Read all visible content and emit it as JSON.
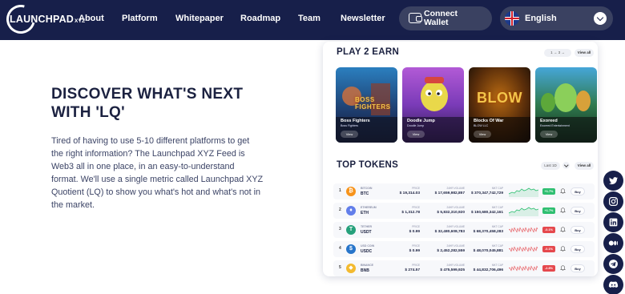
{
  "nav": {
    "logo": {
      "text": "LAUNCHPAD",
      "suffix": "XYZ"
    },
    "links": [
      "About",
      "Platform",
      "Whitepaper",
      "Roadmap",
      "Team",
      "Newsletter"
    ],
    "connect_wallet": "Connect Wallet",
    "language": "English",
    "icons": {
      "wallet": "wallet-icon",
      "flag": "uk-flag-icon",
      "chevron": "chevron-down-icon"
    }
  },
  "hero": {
    "title": "DISCOVER WHAT'S NEXT WITH 'LQ'",
    "description": "Tired of having to use 5-10 different platforms to get the right information? The Launchpad XYZ Feed is Web3 all in one place, in an easy-to-understand format. We'll use a single metric called Launchpad XYZ Quotient (LQ) to show you what's hot and what's not in the market."
  },
  "play2earn": {
    "title": "PLAY 2 EARN",
    "pager": "1 → 3 →",
    "view_all": "View all",
    "games": [
      {
        "name": "Boss Fighters",
        "subtitle": "Boss Fighters",
        "view": "View",
        "logo_text": "BOSS FIGHTERS"
      },
      {
        "name": "Doodle Jump",
        "subtitle": "Doodle Jump",
        "view": "View",
        "logo_text": ""
      },
      {
        "name": "Blocks Of War",
        "subtitle": "BLOW LLC",
        "view": "View",
        "logo_text": "BLOW"
      },
      {
        "name": "Exoreed",
        "subtitle": "Exoreed Entertainment",
        "view": "View",
        "logo_text": ""
      }
    ]
  },
  "top_tokens": {
    "title": "TOP TOKENS",
    "filter": "Last 1D",
    "view_all": "View all",
    "col_labels": {
      "price": "PRICE",
      "volume": "24HR VOLUME",
      "mcap": "MKT CAP"
    },
    "buy_label": "Buy",
    "rows": [
      {
        "rank": "1",
        "name": "BITCOIN",
        "symbol": "BTC",
        "price": "$ 19,314.03",
        "volume": "$ 17,659,982,857",
        "mcap": "$ 370,347,742,729",
        "change": "+1.7%",
        "trend": "up",
        "color": "#f7931a",
        "glyph": "₿"
      },
      {
        "rank": "2",
        "name": "ETHEREUM",
        "symbol": "ETH",
        "price": "$ 1,312.78",
        "volume": "$ 5,832,310,920",
        "mcap": "$ 150,680,342,161",
        "change": "+1.7%",
        "trend": "up",
        "color": "#627eea",
        "glyph": "♦"
      },
      {
        "rank": "3",
        "name": "TETHER",
        "symbol": "USDT",
        "price": "$ 0.99",
        "volume": "$ 32,480,608,783",
        "mcap": "$ 68,370,458,283",
        "change": "-0.1%",
        "trend": "down",
        "color": "#26a17b",
        "glyph": "T"
      },
      {
        "rank": "4",
        "name": "USD COIN",
        "symbol": "USDC",
        "price": "$ 0.99",
        "volume": "$ 2,452,282,559",
        "mcap": "$ 48,070,045,881",
        "change": "-0.1%",
        "trend": "down",
        "color": "#2775ca",
        "glyph": "$"
      },
      {
        "rank": "5",
        "name": "BINANCE",
        "symbol": "BNB",
        "price": "$ 274.57",
        "volume": "$ 475,599,925",
        "mcap": "$ 44,832,706,496",
        "change": "-2.8%",
        "trend": "down",
        "color": "#f3ba2f",
        "glyph": "◆"
      }
    ]
  },
  "colors": {
    "navy": "#171f4a",
    "green": "#2fbf71",
    "red": "#e5484d"
  },
  "social": [
    "twitter-icon",
    "instagram-icon",
    "linkedin-icon",
    "medium-icon",
    "telegram-icon",
    "discord-icon"
  ]
}
